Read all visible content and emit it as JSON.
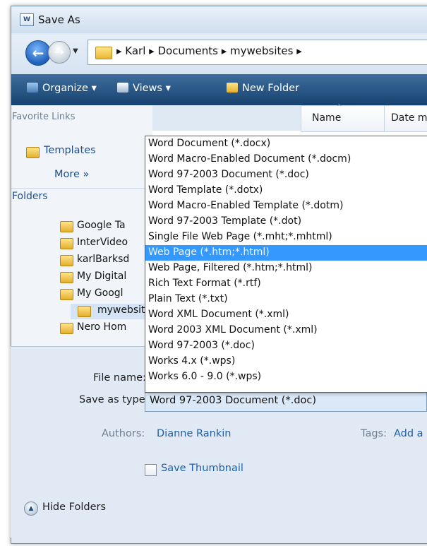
{
  "window": {
    "title": "Save As",
    "icon_name": "word-document-icon",
    "icon_text": "W"
  },
  "nav": {
    "breadcrumb": "▸  Karl  ▸  Documents  ▸  mywebsites  ▸"
  },
  "toolbar": {
    "organize": "Organize  ▾",
    "views": "Views   ▾",
    "new_folder": "New Folder"
  },
  "columns": {
    "name": "Name",
    "date": "Date m"
  },
  "favorites": {
    "heading": "Favorite Links",
    "templates": "Templates",
    "more": "More  »"
  },
  "folders": {
    "heading": "Folders",
    "items": [
      {
        "label": "Google Ta"
      },
      {
        "label": "InterVideo"
      },
      {
        "label": "karlBarksd"
      },
      {
        "label": "My Digital"
      },
      {
        "label": "My Googl"
      },
      {
        "label": "mywebsite"
      },
      {
        "label": "Nero Hom"
      }
    ]
  },
  "save_types": {
    "selected_index": 7,
    "items": [
      "Word Document (*.docx)",
      "Word Macro-Enabled Document (*.docm)",
      "Word 97-2003 Document (*.doc)",
      "Word Template (*.dotx)",
      "Word Macro-Enabled Template (*.dotm)",
      "Word 97-2003 Template (*.dot)",
      "Single File Web Page (*.mht;*.mhtml)",
      "Web Page (*.htm;*.html)",
      "Web Page, Filtered (*.htm;*.html)",
      "Rich Text Format (*.rtf)",
      "Plain Text (*.txt)",
      "Word XML Document (*.xml)",
      "Word 2003 XML Document (*.xml)",
      "Word 97-2003 (*.doc)",
      "Works 4.x (*.wps)",
      "Works 6.0 - 9.0 (*.wps)"
    ]
  },
  "form": {
    "file_name_label": "File name:",
    "file_name_value": "",
    "save_as_type_label": "Save as type:",
    "save_as_type_value": "Word 97-2003 Document (*.doc)",
    "authors_label": "Authors:",
    "authors_value": "Dianne Rankin",
    "tags_label": "Tags:",
    "tags_value": "Add a",
    "save_thumbnail": "Save Thumbnail",
    "save_thumbnail_checked": false,
    "hide_folders": "Hide Folders"
  },
  "colors": {
    "toolbar": "#1f4f7f",
    "highlight": "#3399ff",
    "link": "#1f5fa8"
  }
}
